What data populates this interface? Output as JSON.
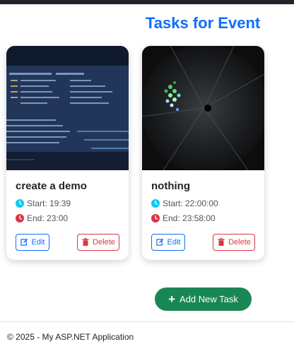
{
  "page": {
    "title": "Tasks for Event"
  },
  "tasks": [
    {
      "title": "create a demo",
      "start": "Start: 19:39",
      "end": "End: 23:00",
      "edit_label": "Edit",
      "delete_label": "Delete",
      "image_icon": "code-screen-photo"
    },
    {
      "title": "nothing",
      "start": "Start: 22:00:00",
      "end": "End: 23:58:00",
      "edit_label": "Edit",
      "delete_label": "Delete",
      "image_icon": "camera-lens-photo"
    }
  ],
  "actions": {
    "add_task_label": "Add New Task"
  },
  "footer": {
    "text": "© 2025 - My ASP.NET Application"
  },
  "colors": {
    "primary": "#0d6efd",
    "danger": "#dc3545",
    "success": "#198754",
    "clock_icon": "#0dcaf0"
  }
}
